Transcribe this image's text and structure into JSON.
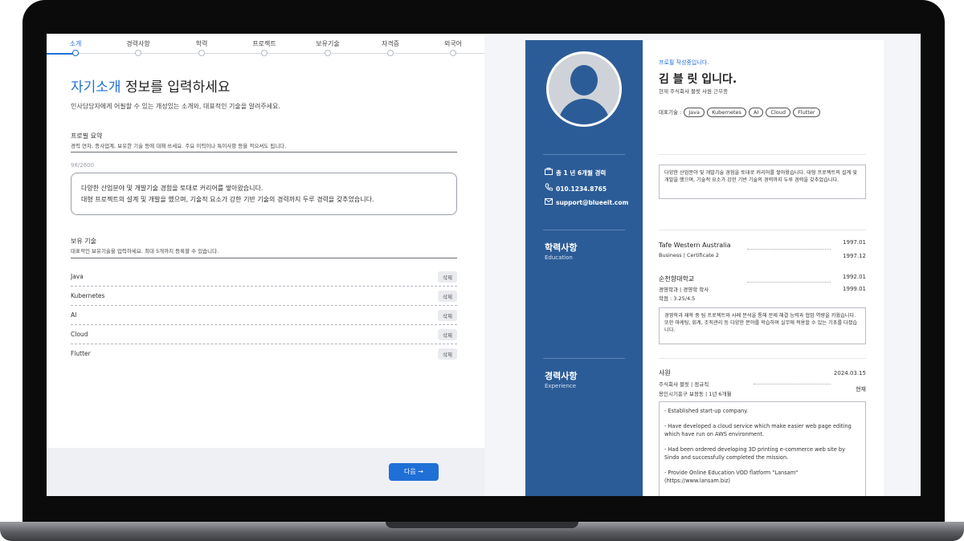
{
  "steps": [
    "소개",
    "경력사항",
    "학력",
    "프로젝트",
    "보유기술",
    "자격증",
    "외국어"
  ],
  "form": {
    "title_highlight": "자기소개",
    "title_rest": " 정보를 입력하세요",
    "subtitle": "인사담당자에게 어필할 수 있는 개성있는 소개와, 대표적인 기술을 알려주세요.",
    "summary_label": "프로필 요약",
    "summary_hint": "경력 연차, 종사업계, 보유한 기술 등에 대해 쓰세요. 주요 이력이나 특이사항 등을 적으셔도 됩니다.",
    "counter": "98/2600",
    "summary_line1": "다양한 산업분야 및 개발기술 경험을 토대로 커리어를 쌓아왔습니다.",
    "summary_line2": "대형 프로젝트의 설계 및 개발을 했으며, 기술적 요소가 강한 기반 기술의 경력까지 두루 경력을 갖추었습니다.",
    "skills_label": "보유 기술",
    "skills_hint": "대표적인 보유기술을 입력하세요. 최대 5개까지 등록할 수 있습니다.",
    "skills": [
      "Java",
      "Kubernetes",
      "AI",
      "Cloud",
      "Flutter"
    ],
    "delete_label": "삭제",
    "next_label": "다음 →"
  },
  "resume": {
    "status": "프로필 작성중입니다.",
    "name": "김 블 릿   입니다.",
    "now_prefix": "현재",
    "now_company": "주식회사 블릿 사원",
    "now_suffix": "근무중",
    "skills_label": "대표기술 :",
    "skills": [
      "Java",
      "Kubernetes",
      "AI",
      "Cloud",
      "Flutter"
    ],
    "contact_career": "총 1 년 6개월 경력",
    "contact_phone": "010.1234.8765",
    "contact_email": "support@blueeit.com",
    "summary": "다양한 산업분야 및 개발기술 경험을 토대로 커리어를 쌓아왔습니다. 대형 프로젝트의 설계 및 개발을 했으며, 기술적 요소가 강한 기반 기술의 경력까지 두루 경력을 갖추었습니다.",
    "edu_head": "학력사항",
    "edu_sub": "Education",
    "edu1_school": "Tafe Western Australia",
    "edu1_detail": "Business | Certificate 2",
    "edu1_start": "1997.01",
    "edu1_end": "1997.12",
    "edu2_school": "순천향대학교",
    "edu2_detail": "경영학과 | 경영학 학사",
    "edu2_gpa": "학점 : 3.25/4.5",
    "edu2_start": "1992.01",
    "edu2_end": "1999.01",
    "edu_desc": "경영학과 재학 중 팀 프로젝트와 사례 분석을 통해 문제 해결 능력과 협업 역량을 키웠습니다. 또한 마케팅, 회계, 조직관리 등 다양한 분야를 학습하며 실무에 적용할 수 있는 기초를 다졌습니다.",
    "exp_head": "경력사항",
    "exp_sub": "Experience",
    "exp_title": "사원",
    "exp_company": "주식회사 블릿 | 정규직",
    "exp_location": "용인시기흥구 보정동 | 1년 6개월",
    "exp_start": "2024.03.15",
    "exp_end": "현재",
    "exp_items": [
      "- Established start-up company.",
      "- Have developed a cloud service which make easier web page editing which have run on AWS environment.",
      "- Had been ordered developing 3D printing e-commerce web site by Sindo and successfully completed the mission.",
      "- Provide Online Education VOD flatform \"Lansam\" (https://www.lansam.biz)"
    ]
  },
  "icons": {
    "career": "briefcase-icon",
    "phone": "phone-icon",
    "email": "mail-icon"
  },
  "colors": {
    "accent": "#1f6fd6",
    "sidebar": "#2c5c97"
  }
}
